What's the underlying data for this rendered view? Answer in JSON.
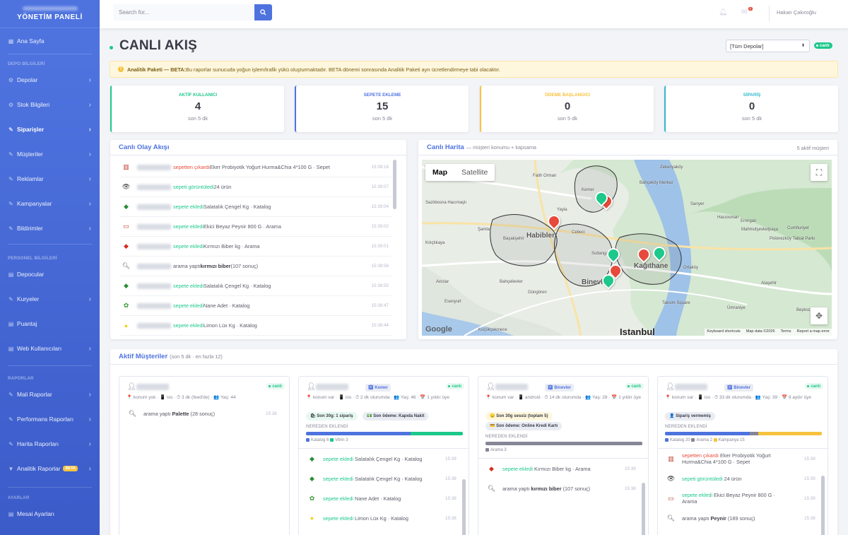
{
  "brand": {
    "title": "YÖNETİM PANELİ"
  },
  "nav": {
    "home": "Ana Sayfa",
    "sec_depo": "DEPO BİLGİLERİ",
    "depolar": "Depolar",
    "stok": "Stok Bilgileri",
    "siparisler": "Siparişler",
    "musteriler": "Müşteriler",
    "reklamlar": "Reklamlar",
    "kampanyalar": "Kampanyalar",
    "bildirimler": "Bildirimler",
    "sec_personel": "PERSONEL BİLGİLERİ",
    "depocular": "Depocular",
    "kuryeler": "Kuryeler",
    "puantaj": "Puantaj",
    "web": "Web Kullanıcıları",
    "sec_rapor": "RAPORLAR",
    "mali": "Mali Raporlar",
    "perf": "Performans Raporları",
    "harita": "Harita Raporları",
    "analitik": "Analitik Raporlar",
    "beta": "BETA",
    "sec_ayar": "AYARLAR",
    "mesai": "Mesai Ayarları"
  },
  "topbar": {
    "search_placeholder": "Search for...",
    "notif_count": "7",
    "user": "Hakan Çakıroğlu"
  },
  "page": {
    "title": "CANLI AKIŞ",
    "select": "[Tüm Depolar]",
    "live": "canlı"
  },
  "alert": {
    "bold": "Analitik Paketi — BETA:",
    "text": " Bu raporlar sunucuda yoğun işlem/trafik yükü oluşturmaktadır. BETA dönemi sonrasında Analitik Paketi ayrı ücretlendirmeye tabi olacaktır."
  },
  "kpis": [
    {
      "label": "AKTİF KULLANICI",
      "value": "4",
      "sub": "son 5 dk",
      "color": "#1cc88a"
    },
    {
      "label": "SEPETE EKLEME",
      "value": "15",
      "sub": "son 5 dk",
      "color": "#4e73df"
    },
    {
      "label": "ÖDEME BAŞLANGICI",
      "value": "0",
      "sub": "son 5 dk",
      "color": "#f6c23e"
    },
    {
      "label": "SİPARİŞ",
      "value": "0",
      "sub": "son 5 dk",
      "color": "#36b9cc"
    }
  ],
  "feed": {
    "title": "Canlı Olay Akışı",
    "events": [
      {
        "action": "sepetten çıkardı",
        "action_color": "red",
        "item": " Eker Probiyotik Yoğurt Hurma&Chia 4*100 G · Sepet",
        "time": "15:39:16",
        "icon": "yogurt"
      },
      {
        "action": "sepeti görüntüledi",
        "action_color": "green",
        "item": " 24 ürün",
        "time": "15:39:07",
        "icon": "eye"
      },
      {
        "action": "sepete ekledi",
        "action_color": "green",
        "item": " Salatalık Çengel Kg · Katalog",
        "time": "15:39:04",
        "icon": "cucumber"
      },
      {
        "action": "sepete ekledi",
        "action_color": "green",
        "item": " Ekici Beyaz Peynir 800 G · Arama",
        "time": "15:39:02",
        "icon": "cheese"
      },
      {
        "action": "sepete ekledi",
        "action_color": "green",
        "item": " Kırmızı Biber kg · Arama",
        "time": "15:39:01",
        "icon": "pepper"
      },
      {
        "action": "arama yaptı",
        "action_color": "plain",
        "item": " kırmızı biber",
        "item_bold": true,
        "suffix": " (107 sonuç)",
        "time": "15:38:56",
        "icon": "search"
      },
      {
        "action": "sepete ekledi",
        "action_color": "green",
        "item": " Salatalık Çengel Kg · Katalog",
        "time": "15:38:55",
        "icon": "cucumber"
      },
      {
        "action": "sepete ekledi",
        "action_color": "green",
        "item": " Nane Adet · Katalog",
        "time": "15:38:47",
        "icon": "mint"
      },
      {
        "action": "sepete ekledi",
        "action_color": "green",
        "item": " Limon Lüx Kg · Katalog",
        "time": "15:38:44",
        "icon": "lemon"
      }
    ]
  },
  "map": {
    "title": "Canlı Harita",
    "subtitle": "— müşteri konumu + kapsama",
    "count": "5 aktif müşteri",
    "tab_map": "Map",
    "tab_sat": "Satellite",
    "labels": [
      "Fatih Orman",
      "Kemer",
      "Bahçeköy Merkez",
      "Zekeriyaköy",
      "Sazlıbosna Hacımaşlı",
      "Yayla",
      "Habibler",
      "Cebeci",
      "Şamlar",
      "Başakşehir",
      "Hacıosman",
      "Emirgan",
      "Mahmutşevketpaşa",
      "Kağıthane",
      "Polonezköy Tabiat Parkı",
      "Binevler",
      "Esenyurt",
      "Istanbul",
      "Cumhuriyet",
      "Ümraniye",
      "Taksim Square",
      "Küçükçekmece",
      "Ataşehir",
      "Kılıçlıkaya",
      "Beykoz",
      "Bahçelievler",
      "Avcılar",
      "Sultangazi",
      "Güngören",
      "Sarıyer",
      "Ortaköy"
    ],
    "footer": [
      "Keyboard shortcuts",
      "Map data ©2026",
      "Terms",
      "Report a map error"
    ],
    "google": "Google"
  },
  "active": {
    "title": "Aktif Müşteriler",
    "subtitle": "(son 5 dk · en fazla 12)",
    "customers": [
      {
        "chip": "",
        "meta": "📍 konum yok · 📱 ios · ⏱ 3 dk (feed'de) · 👥 Yaş: 44",
        "pills": [],
        "from": "",
        "legend": [],
        "bar": [],
        "events": [
          {
            "action": "arama yaptı",
            "color": "plain",
            "item": " Palette",
            "bold": true,
            "suffix": " (28 sonuç)",
            "time": "15:36",
            "icon": "search"
          }
        ]
      },
      {
        "chip": "Kemer",
        "meta": "📍 konum var · 📱 ios · ⏱ 2 dk oturumda · 👥 Yaş: 46 · 📅 1 yıldır üye",
        "pills": [
          {
            "text": "🛍 Son 30g: 1 sipariş",
            "bg": "#e7f8f1"
          },
          {
            "text": "💵 Son ödeme: Kapıda Nakit",
            "bg": "#eaecf4"
          }
        ],
        "from": "NEREDEN EKLENDİ",
        "legend": [
          {
            "name": "Katalog 6",
            "color": "#4e73df"
          },
          {
            "name": "Vitrin 3",
            "color": "#1cc88a"
          }
        ],
        "bar": [
          {
            "frac": 0.667,
            "color": "#4e73df"
          },
          {
            "frac": 0.333,
            "color": "#1cc88a"
          }
        ],
        "events": [
          {
            "action": "sepete ekledi",
            "color": "green",
            "item": " Salatalık Çengel Kg · Katalog",
            "time": "15:39",
            "icon": "cucumber"
          },
          {
            "action": "sepete ekledi",
            "color": "green",
            "item": " Salatalık Çengel Kg · Katalog",
            "time": "15:38",
            "icon": "cucumber"
          },
          {
            "action": "sepete ekledi",
            "color": "green",
            "item": " Nane Adet · Katalog",
            "time": "15:38",
            "icon": "mint"
          },
          {
            "action": "sepete ekledi",
            "color": "green",
            "item": " Limon Lüx Kg · Katalog",
            "time": "15:38",
            "icon": "lemon"
          }
        ]
      },
      {
        "chip": "Binevler",
        "meta": "📍 konum var · 📱 android · ⏱ 14 dk oturumda · 👥 Yaş: 28 · 📅 1 yıldır üye",
        "pills": [
          {
            "text": "😞 Son 30g sessiz (toplam 5)",
            "bg": "#fef7dd"
          },
          {
            "text": "💳 Son ödeme: Online Kredi Kartı",
            "bg": "#eaecf4"
          }
        ],
        "from": "NEREDEN EKLENDİ",
        "legend": [
          {
            "name": "Arama 3",
            "color": "#858796"
          }
        ],
        "bar": [
          {
            "frac": 1,
            "color": "#858796"
          }
        ],
        "events": [
          {
            "action": "sepete ekledi",
            "color": "green",
            "item": " Kırmızı Biber kg · Arama",
            "time": "15:39",
            "icon": "pepper"
          },
          {
            "action": "arama yaptı",
            "color": "plain",
            "item": " kırmızı biber",
            "bold": true,
            "suffix": " (107 sonuç)",
            "time": "15:38",
            "icon": "search"
          }
        ]
      },
      {
        "chip": "Binevler",
        "meta": "📍 konum var · 📱 ios · ⏱ 33 dk oturumda · 👥 Yaş: 39 · 📅 9 aydır üye",
        "pills": [
          {
            "text": "👤 Sipariş vermemiş",
            "bg": "#eaecf4"
          }
        ],
        "from": "NEREDEN EKLENDİ",
        "legend": [
          {
            "name": "Katalog 20",
            "color": "#4e73df"
          },
          {
            "name": "Arama 2",
            "color": "#858796"
          },
          {
            "name": "Kampanya 15",
            "color": "#f6c23e"
          }
        ],
        "bar": [
          {
            "frac": 0.54,
            "color": "#4e73df"
          },
          {
            "frac": 0.054,
            "color": "#858796"
          },
          {
            "frac": 0.406,
            "color": "#f6c23e"
          }
        ],
        "events": [
          {
            "action": "sepetten çıkardı",
            "color": "red",
            "item": " Eker Probiyotik Yoğurt Hurma&Chia 4*100 G · Sepet",
            "time": "15:39",
            "icon": "yogurt"
          },
          {
            "action": "sepeti görüntüledi",
            "color": "green",
            "item": " 24 ürün",
            "time": "15:39",
            "icon": "eye"
          },
          {
            "action": "sepete ekledi",
            "color": "green",
            "item": " Ekici Beyaz Peynir 800 G · Arama",
            "time": "15:39",
            "icon": "cheese"
          },
          {
            "action": "arama yaptı",
            "color": "plain",
            "item": " Peynir",
            "bold": true,
            "suffix": " (189 sonuç)",
            "time": "15:38",
            "icon": "search"
          }
        ]
      }
    ]
  }
}
